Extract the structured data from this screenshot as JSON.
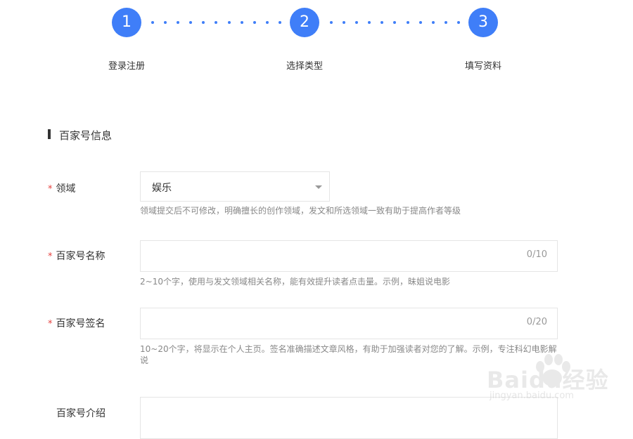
{
  "stepper": {
    "steps": [
      {
        "number": "1",
        "label": "登录注册"
      },
      {
        "number": "2",
        "label": "选择类型"
      },
      {
        "number": "3",
        "label": "填写资料"
      }
    ],
    "accent_color": "#3f7ef8"
  },
  "section": {
    "title": "百家号信息"
  },
  "form": {
    "domain": {
      "required": "*",
      "label": "领域",
      "value": "娱乐",
      "hint": "领域提交后不可修改，明确擅长的创作领域，发文和所选领域一致有助于提高作者等级"
    },
    "name": {
      "required": "*",
      "label": "百家号名称",
      "value": "",
      "counter": "0/10",
      "hint": "2~10个字，使用与发文领域相关名称，能有效提升读者点击量。示例，昧姐说电影"
    },
    "signature": {
      "required": "*",
      "label": "百家号签名",
      "value": "",
      "counter": "0/20",
      "hint": "10~20个字，将显示在个人主页。签名准确描述文章风格，有助于加强读者对您的了解。示例，专注科幻电影解说"
    },
    "intro": {
      "label": "百家号介绍"
    }
  },
  "watermark": {
    "text": "Baidu经验",
    "sub": "jingyan.baidu.com"
  }
}
